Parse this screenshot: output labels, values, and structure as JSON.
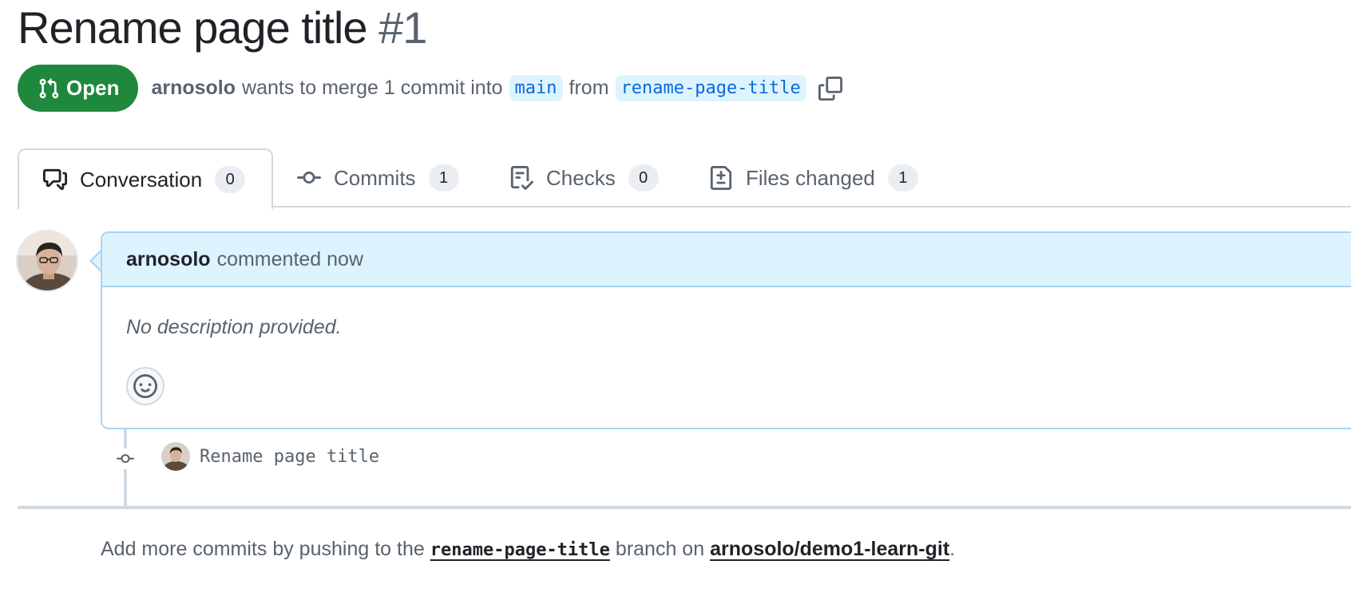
{
  "pr": {
    "title": "Rename page title",
    "number": "#1",
    "state": "Open",
    "author": "arnosolo",
    "merge_text": "wants to merge 1 commit into",
    "base_branch": "main",
    "from_text": "from",
    "head_branch": "rename-page-title"
  },
  "tabs": [
    {
      "label": "Conversation",
      "count": "0",
      "icon": "comment-discussion-icon"
    },
    {
      "label": "Commits",
      "count": "1",
      "icon": "git-commit-icon"
    },
    {
      "label": "Checks",
      "count": "0",
      "icon": "checklist-icon"
    },
    {
      "label": "Files changed",
      "count": "1",
      "icon": "file-diff-icon"
    }
  ],
  "comment": {
    "author": "arnosolo",
    "action": "commented now",
    "body": "No description provided."
  },
  "commit": {
    "message": "Rename page title"
  },
  "footer": {
    "prefix": "Add more commits by pushing to the",
    "branch": "rename-page-title",
    "middle": "branch on",
    "repo": "arnosolo/demo1-learn-git",
    "suffix": "."
  },
  "colors": {
    "open_green": "#1f883d",
    "branch_bg": "#ddf4ff",
    "link_blue": "#0969da",
    "comment_border": "#a8d4f5"
  }
}
